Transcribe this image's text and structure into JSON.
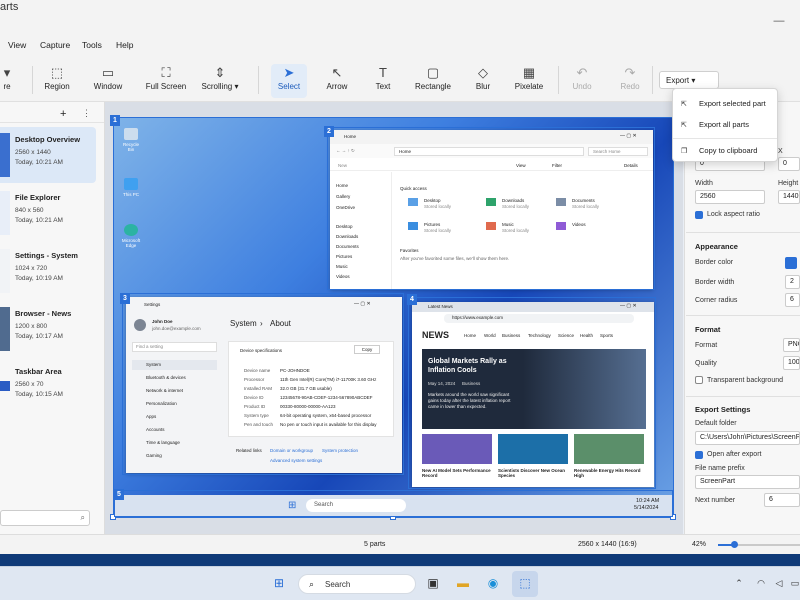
{
  "window": {
    "title": "arts",
    "minimize": "—"
  },
  "menu": [
    "View",
    "Capture",
    "Tools",
    "Help"
  ],
  "toolbar": {
    "tools": [
      {
        "label": "re",
        "icon": "new-icon"
      },
      {
        "label": "Region",
        "icon": "region-icon"
      },
      {
        "label": "Window",
        "icon": "window-icon"
      },
      {
        "label": "Full Screen",
        "icon": "fullscreen-icon"
      },
      {
        "label": "Scrolling",
        "icon": "scrolling-icon"
      },
      {
        "label": "Select",
        "icon": "cursor-icon",
        "selected": true
      },
      {
        "label": "Arrow",
        "icon": "arrow-icon"
      },
      {
        "label": "Text",
        "icon": "text-icon"
      },
      {
        "label": "Rectangle",
        "icon": "rectangle-icon"
      },
      {
        "label": "Blur",
        "icon": "blur-icon"
      },
      {
        "label": "Pixelate",
        "icon": "pixelate-icon"
      },
      {
        "label": "Undo",
        "icon": "undo-icon",
        "disabled": true
      },
      {
        "label": "Redo",
        "icon": "redo-icon",
        "disabled": true
      }
    ],
    "export_label": "Export"
  },
  "export_menu": [
    "Export selected part",
    "Export all parts",
    "Copy to clipboard"
  ],
  "sidebar": {
    "add": "+",
    "parts": [
      {
        "name": "Desktop Overview",
        "size": "2560 x 1440",
        "time": "Today, 10:21 AM"
      },
      {
        "name": "File Explorer",
        "size": "840 x 560",
        "time": "Today, 10:21 AM"
      },
      {
        "name": "Settings - System",
        "size": "1024 x 720",
        "time": "Today, 10:19 AM"
      },
      {
        "name": "Browser - News",
        "size": "1200 x 800",
        "time": "Today, 10:17 AM"
      },
      {
        "name": "Taskbar Area",
        "size": "2560 x 70",
        "time": "Today, 10:15 AM"
      }
    ]
  },
  "canvas": {
    "badges": [
      "1",
      "2",
      "3",
      "4",
      "5"
    ],
    "desktop_icons": [
      "Recycle Bin",
      "This PC",
      "Microsoft Edge"
    ],
    "explorer": {
      "title": "Home",
      "path": "Home",
      "search": "Search Home",
      "new": "New",
      "view": "View",
      "filter": "Filter",
      "details": "Details",
      "nav": [
        "Home",
        "Gallery",
        "OneDrive",
        "Desktop",
        "Downloads",
        "Documents",
        "Pictures",
        "Music",
        "Videos"
      ],
      "quick_access": "Quick access",
      "folders": [
        {
          "name": "Desktop",
          "sub": "Stored locally"
        },
        {
          "name": "Downloads",
          "sub": "Stored locally"
        },
        {
          "name": "Documents",
          "sub": "Stored locally"
        },
        {
          "name": "Pictures",
          "sub": "Stored locally"
        },
        {
          "name": "Music",
          "sub": "Stored locally"
        },
        {
          "name": "Videos",
          "sub": "Stored locally"
        }
      ],
      "favorites": "Favorites",
      "favorites_note": "After you've favorited some files, we'll show them here."
    },
    "settings": {
      "title": "Settings",
      "user": "John Doe",
      "email": "john.doe@example.com",
      "search": "Find a setting",
      "crumb1": "System",
      "crumb2": "About",
      "spec_title": "Device specifications",
      "copy": "Copy",
      "nav": [
        "System",
        "Bluetooth & devices",
        "Network & internet",
        "Personalization",
        "Apps",
        "Accounts",
        "Time & language",
        "Gaming"
      ],
      "rows": [
        {
          "k": "Device name",
          "v": "PC-JOHNDOE"
        },
        {
          "k": "Processor",
          "v": "11th Gen Intel(R) Core(TM) i7-11700K 3.60 GHz"
        },
        {
          "k": "Installed RAM",
          "v": "32.0 GB (31.7 GB usable)"
        },
        {
          "k": "Device ID",
          "v": "12345678-90AB-CDEF-1234-567890ABCDEF"
        },
        {
          "k": "Product ID",
          "v": "00330-80000-00000-AA123"
        },
        {
          "k": "System type",
          "v": "64-bit operating system, x64-based processor"
        },
        {
          "k": "Pen and touch",
          "v": "No pen or touch input is available for this display"
        }
      ],
      "related": "Related links",
      "link1": "Domain or workgroup",
      "link2": "System protection",
      "link3": "Advanced system settings"
    },
    "browser": {
      "tab": "Latest News",
      "url": "https://www.example.com",
      "logo": "NEWS",
      "nav": [
        "Home",
        "World",
        "Business",
        "Technology",
        "Science",
        "Health",
        "Sports"
      ],
      "headline": "Global Markets Rally as Inflation Cools",
      "date": "May 14, 2024",
      "cat": "Business",
      "body": "Markets around the world saw significant gains today after the latest inflation report came in lower than expected.",
      "cards": [
        {
          "title": "New AI Model Sets Performance Record"
        },
        {
          "title": "Scientists Discover New Ocean Species"
        },
        {
          "title": "Renewable Energy Hits Record High"
        }
      ]
    },
    "taskbar": {
      "search": "Search",
      "time": "10:24 AM",
      "date": "5/14/2024"
    }
  },
  "properties": {
    "x_label": "X",
    "y_label": "Y",
    "x": "0",
    "y": "0",
    "width_label": "Width",
    "width": "2560",
    "height_label": "Height",
    "height": "1440",
    "lock_label": "Lock aspect ratio",
    "appearance": "Appearance",
    "border_color_label": "Border color",
    "border_width_label": "Border width",
    "border_width": "2",
    "corner_label": "Corner radius",
    "corner": "6",
    "format_section": "Format",
    "format_label": "Format",
    "format": "PNG",
    "quality_label": "Quality",
    "quality": "100%",
    "transparent_label": "Transparent background",
    "export_settings": "Export Settings",
    "folder_label": "Default folder",
    "folder": "C:\\Users\\John\\Pictures\\ScreenPart",
    "open_after": "Open after export",
    "prefix_label": "File name prefix",
    "prefix": "ScreenPart",
    "next_label": "Next number",
    "next": "6",
    "accent": "#2b6fd6"
  },
  "status": {
    "parts": "5 parts",
    "dims": "2560 x 1440 (16:9)",
    "zoom": "42%"
  },
  "os_taskbar": {
    "search": "Search"
  }
}
